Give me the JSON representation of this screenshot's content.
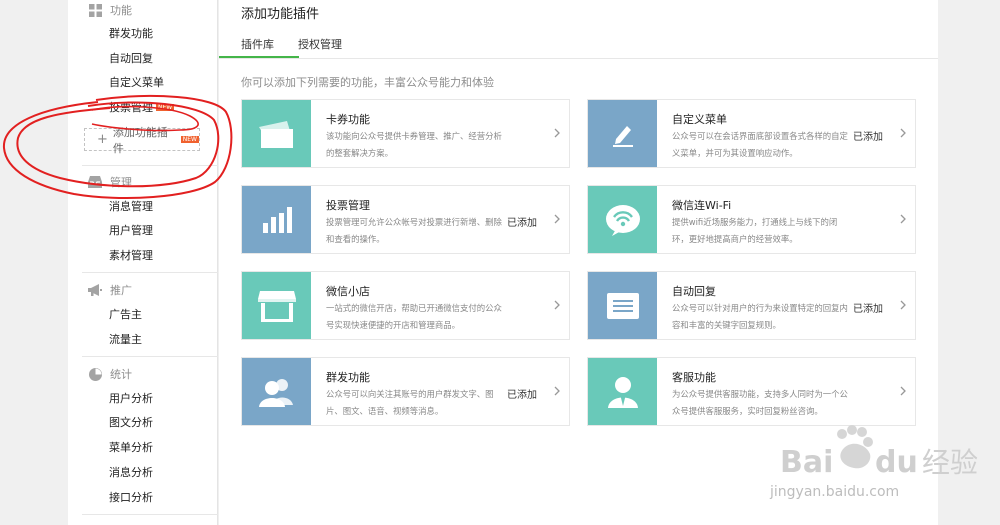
{
  "sidebar": {
    "groups": {
      "feature": {
        "title": "功能",
        "icon": "grid-icon",
        "items": [
          "群发功能",
          "自动回复",
          "自定义菜单",
          "投票管理"
        ],
        "add_plugin": "添加功能插件"
      },
      "manage": {
        "title": "管理",
        "icon": "inbox-icon",
        "items": [
          "消息管理",
          "用户管理",
          "素材管理"
        ]
      },
      "promo": {
        "title": "推广",
        "icon": "megaphone-icon",
        "items": [
          "广告主",
          "流量主"
        ]
      },
      "stats": {
        "title": "统计",
        "icon": "pie-chart-icon",
        "items": [
          "用户分析",
          "图文分析",
          "菜单分析",
          "消息分析",
          "接口分析"
        ]
      }
    },
    "badge": "NEW"
  },
  "main": {
    "title": "添加功能插件",
    "tabs": [
      "插件库",
      "授权管理"
    ],
    "intro": "你可以添加下列需要的功能，丰富公众号能力和体验",
    "cards": [
      {
        "title": "卡券功能",
        "desc": "该功能向公众号提供卡券管理、推广、经营分析的整套解决方案。",
        "added": "",
        "icon": "card-icon",
        "color": "#69c9b9"
      },
      {
        "title": "自定义菜单",
        "desc": "公众号可以在会话界面底部设置各式各样的自定义菜单，并可为其设置响应动作。",
        "added": "已添加",
        "icon": "edit-icon",
        "color": "#7aa6c8"
      },
      {
        "title": "投票管理",
        "desc": "投票管理可允许公众帐号对投票进行新增、删除和查看的操作。",
        "added": "已添加",
        "icon": "bar-chart-icon",
        "color": "#7aa6c8"
      },
      {
        "title": "微信连Wi-Fi",
        "desc": "提供wifi近场服务能力，打通线上与线下的闭环，更好地提高商户的经营效率。",
        "added": "",
        "icon": "wifi-icon",
        "color": "#69c9b9"
      },
      {
        "title": "微信小店",
        "desc": "一站式的微信开店，帮助已开通微信支付的公众号实现快速便捷的开店和管理商品。",
        "added": "",
        "icon": "shop-icon",
        "color": "#69c9b9"
      },
      {
        "title": "自动回复",
        "desc": "公众号可以针对用户的行为来设置特定的回复内容和丰富的关键字回复规则。",
        "added": "已添加",
        "icon": "message-icon",
        "color": "#7aa6c8"
      },
      {
        "title": "群发功能",
        "desc": "公众号可以向关注其账号的用户群发文字、图片、图文、语音、视频等消息。",
        "added": "已添加",
        "icon": "users-icon",
        "color": "#7aa6c8"
      },
      {
        "title": "客服功能",
        "desc": "为公众号提供客服功能，支持多人同时为一个公众号提供客服服务，实时回复粉丝咨询。",
        "added": "",
        "icon": "service-icon",
        "color": "#69c9b9"
      }
    ]
  },
  "watermark": {
    "brand": "Baidu经验",
    "url": "jingyan.baidu.com"
  }
}
